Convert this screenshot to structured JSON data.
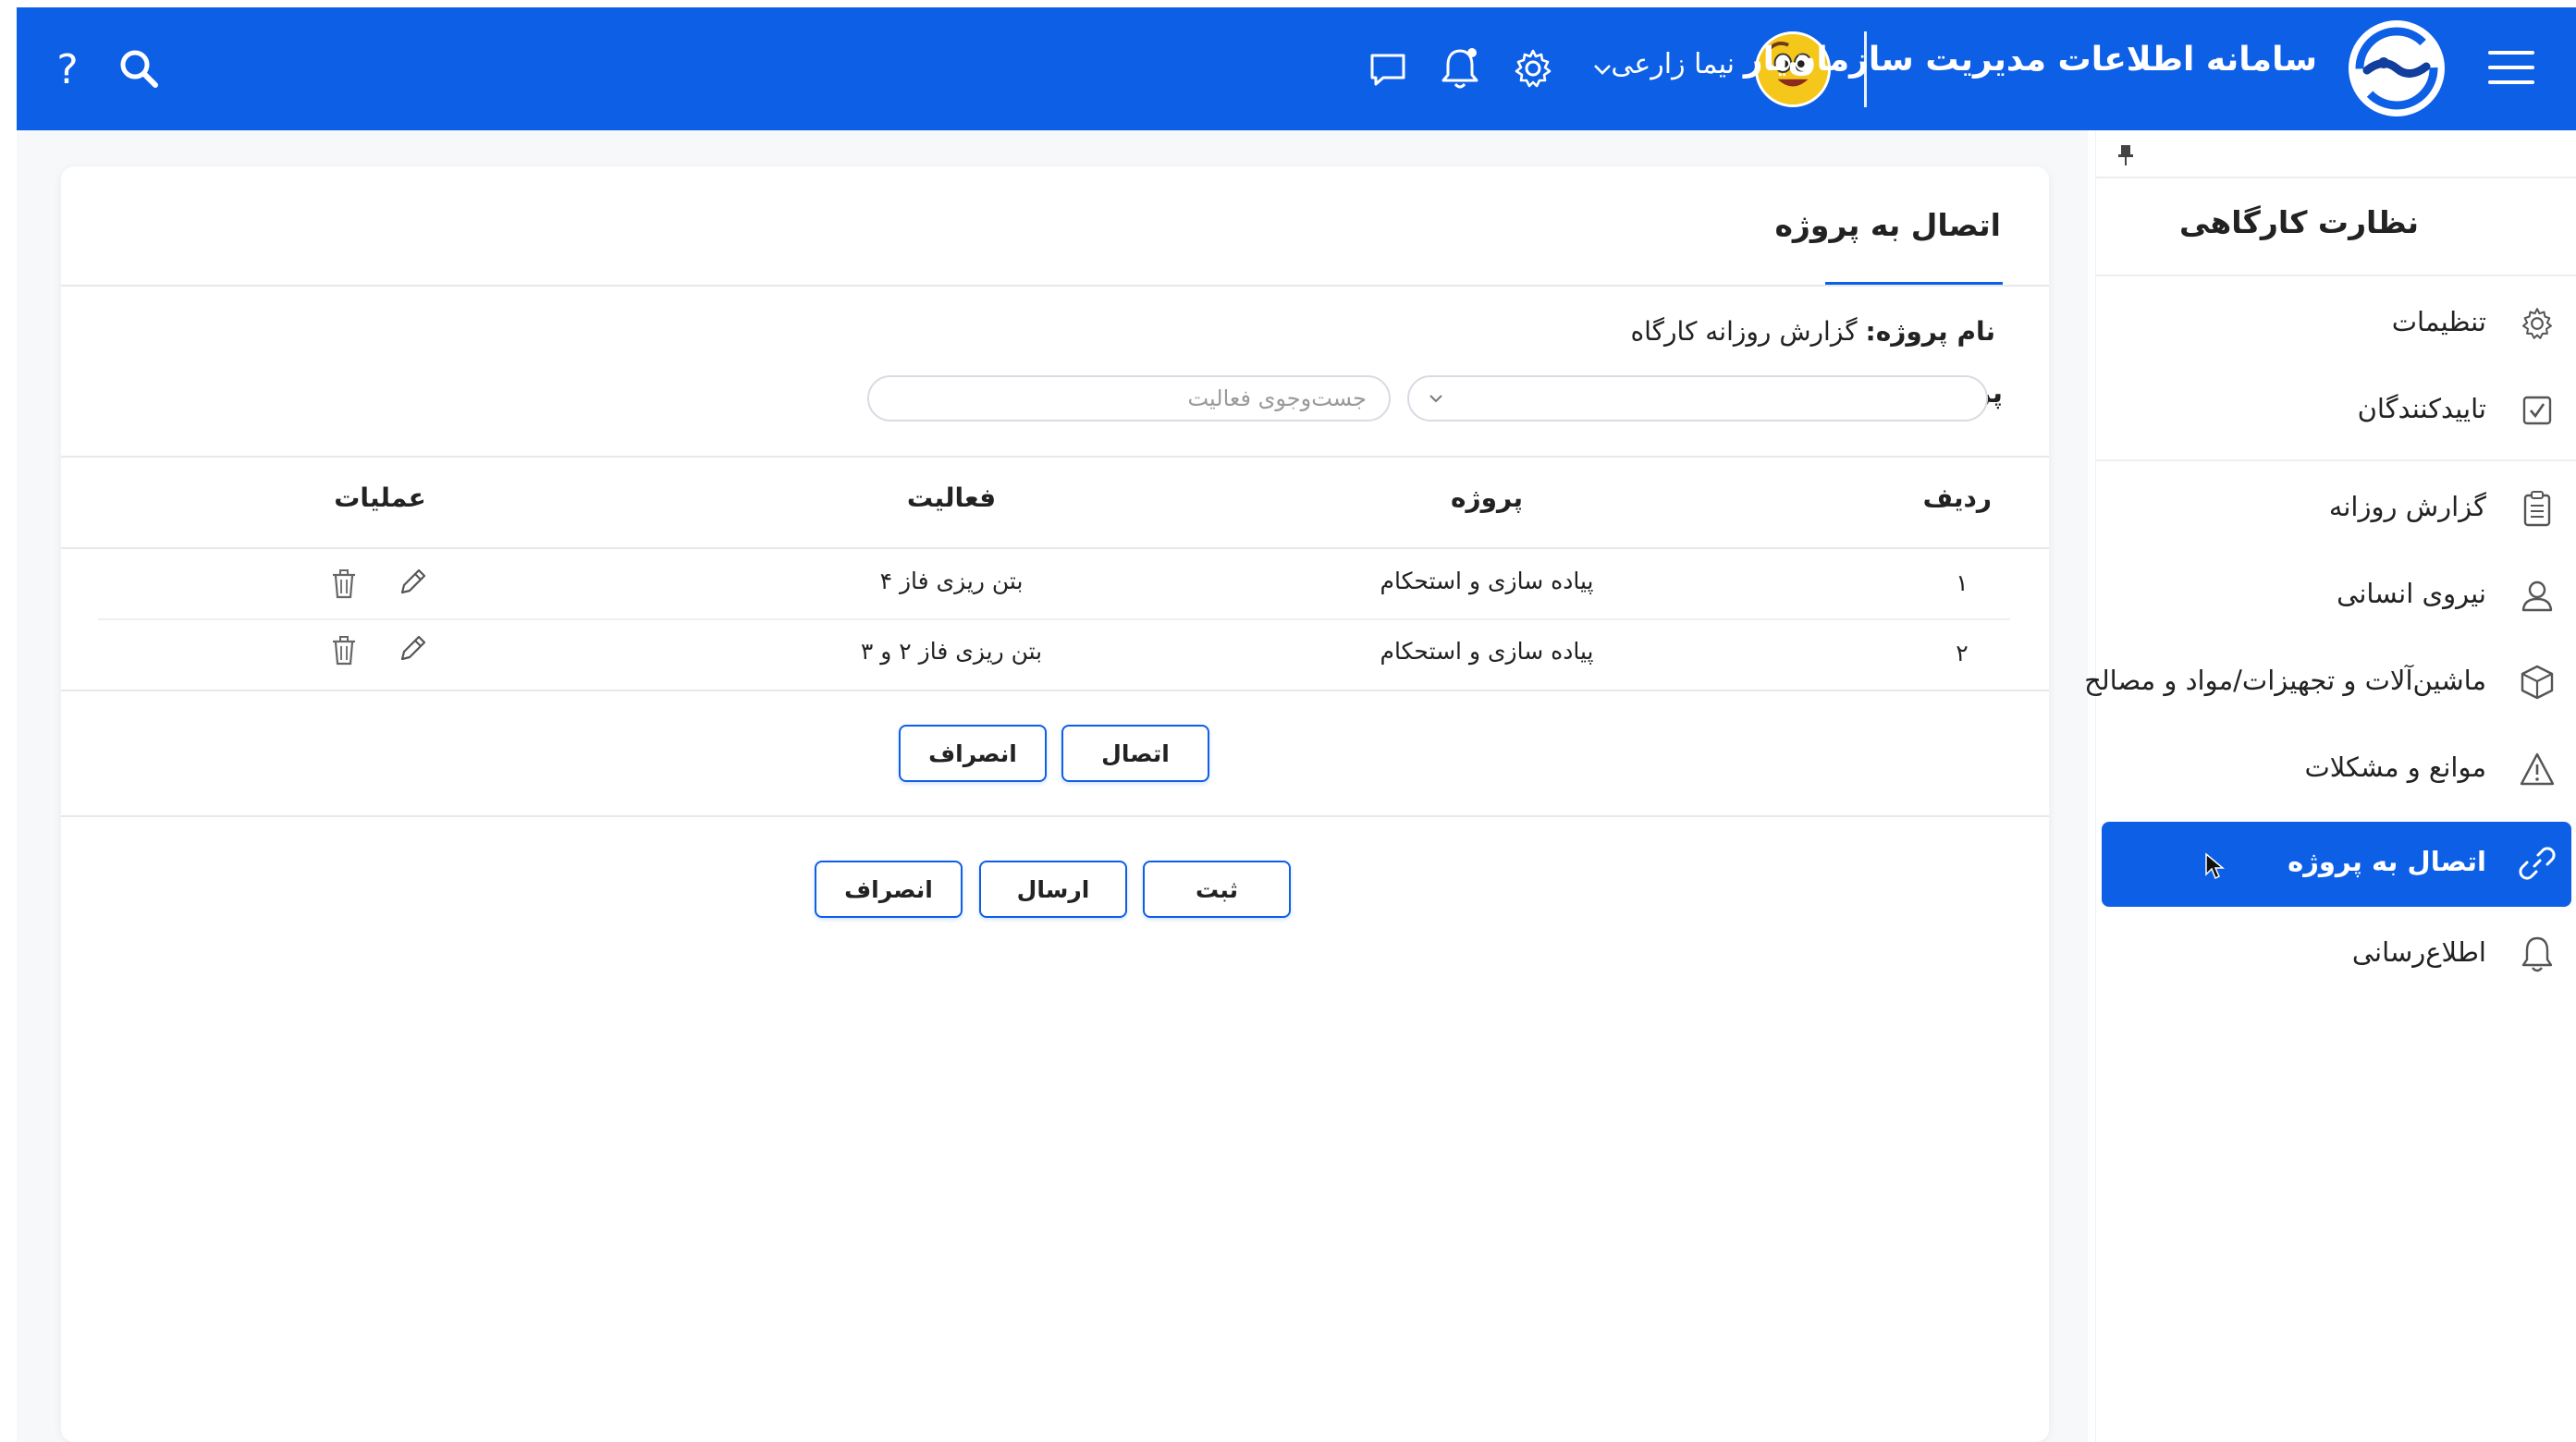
{
  "header": {
    "app_title": "سامانه اطلاعات مدیریت سازمان‌یار",
    "user_name": "نیما زارعی",
    "icons": [
      "menu-icon",
      "logo",
      "avatar",
      "chevron-down-icon",
      "gear-icon",
      "bell-icon",
      "chat-icon",
      "search-icon",
      "help-icon"
    ],
    "help_glyph": "?"
  },
  "card": {
    "title": "اتصال به پروژه",
    "project_name_key": "نام پروژه:",
    "project_name_value": "گزارش روزانه کارگاه",
    "project_field_label": "پروژه",
    "project_select_value": "",
    "search_placeholder": "جست‌وجوی فعالیت",
    "table": {
      "headers": {
        "row": "ردیف",
        "project": "پروژه",
        "activity": "فعالیت",
        "actions": "عملیات"
      },
      "rows": [
        {
          "row": "۱",
          "project": "پیاده سازی و استحکام",
          "activity": "بتن ریزی فاز ۴"
        },
        {
          "row": "۲",
          "project": "پیاده سازی و استحکام",
          "activity": "بتن ریزی فاز ۲ و ۳"
        }
      ]
    },
    "buttons": {
      "connect": "اتصال",
      "cancel_inner": "انصراف",
      "submit": "ثبت",
      "send": "ارسال",
      "cancel_bottom": "انصراف"
    }
  },
  "sidebar": {
    "title": "نظارت کارگاهی",
    "items": [
      {
        "label": "تنظیمات",
        "icon": "gear-icon"
      },
      {
        "label": "تاییدکنندگان",
        "icon": "checkbox-icon"
      },
      {
        "label": "گزارش روزانه",
        "icon": "clipboard-icon"
      },
      {
        "label": "نیروی انسانی",
        "icon": "user-icon"
      },
      {
        "label": "ماشین‌آلات و تجهیزات/مواد و مصالح",
        "icon": "cube-icon"
      },
      {
        "label": "موانع و مشکلات",
        "icon": "warning-icon"
      },
      {
        "label": "اتصال به پروژه",
        "icon": "link-icon",
        "active": true
      },
      {
        "label": "اطلاع‌رسانی",
        "icon": "bell-icon"
      }
    ]
  },
  "colors": {
    "primary": "#0d5fe6",
    "header_text": "#ffffff",
    "border": "#d7dbe2"
  }
}
